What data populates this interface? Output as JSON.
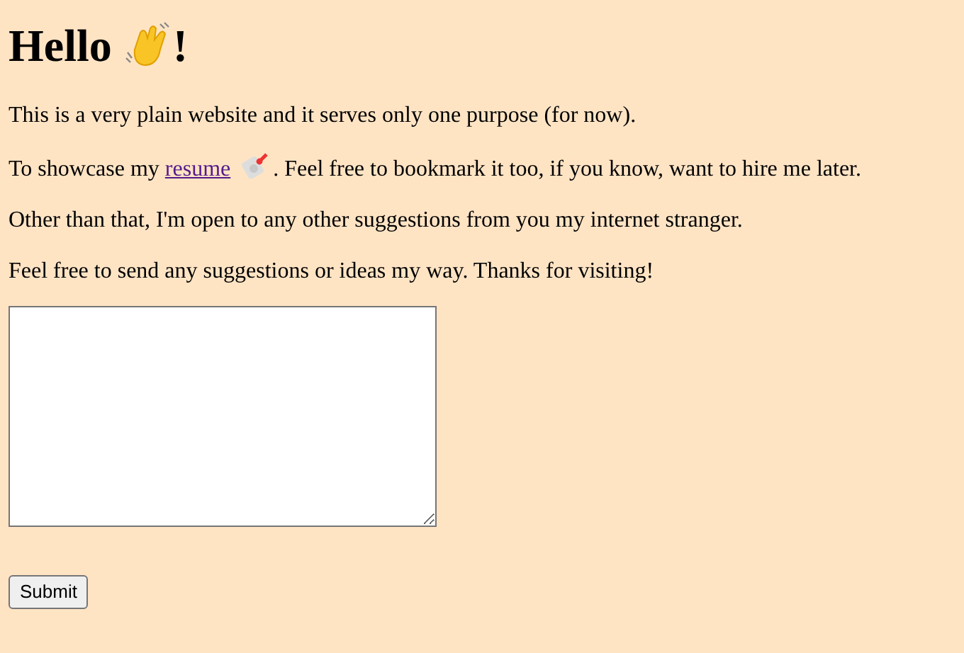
{
  "heading": {
    "before": "Hello",
    "after": "!"
  },
  "paragraphs": [
    {
      "kind": "plain",
      "text": "This is a very plain website and it serves only one purpose (for now)."
    },
    {
      "kind": "link",
      "before": "To showcase my",
      "link": "resume",
      "after": ". Feel free to bookmark it too, if you know, want to hire me later."
    },
    {
      "kind": "plain",
      "text": "Other than that, I'm open to any other suggestions from you my internet stranger."
    },
    {
      "kind": "plain",
      "text": "Feel free to send any suggestions or ideas my way. Thanks for visiting!"
    }
  ],
  "buttons": [
    "Submit"
  ]
}
